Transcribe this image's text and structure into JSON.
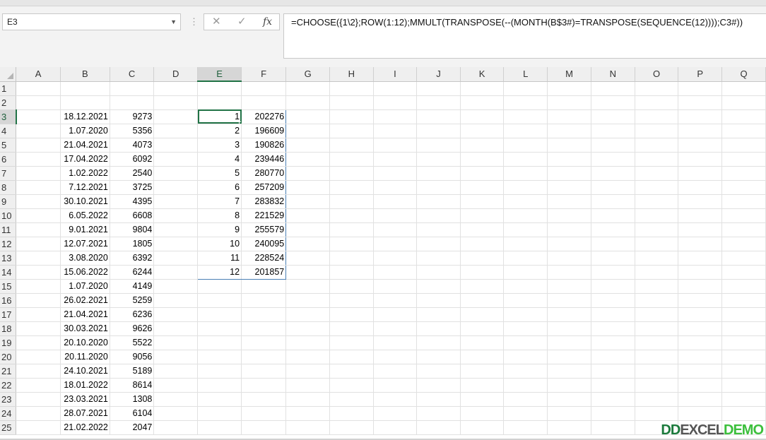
{
  "formula_bar": {
    "name_box": "E3",
    "formula": "=CHOOSE({1\\2};ROW(1:12);MMULT(TRANSPOSE(--(MONTH(B$3#)=TRANSPOSE(SEQUENCE(12))));C3#))",
    "cancel_icon": "cancel-x-icon",
    "enter_icon": "checkmark-icon",
    "fx_label": "fx"
  },
  "columns": [
    "A",
    "B",
    "C",
    "D",
    "E",
    "F",
    "G",
    "H",
    "I",
    "J",
    "K",
    "L",
    "M",
    "N",
    "O",
    "P",
    "Q"
  ],
  "selected_column": "E",
  "selected_row": "3",
  "rows": [
    {
      "n": "1",
      "B": "",
      "C": "",
      "E": "",
      "F": ""
    },
    {
      "n": "2",
      "B": "",
      "C": "",
      "E": "",
      "F": ""
    },
    {
      "n": "3",
      "B": "18.12.2021",
      "C": "9273",
      "E": "1",
      "F": "202276"
    },
    {
      "n": "4",
      "B": "1.07.2020",
      "C": "5356",
      "E": "2",
      "F": "196609"
    },
    {
      "n": "5",
      "B": "21.04.2021",
      "C": "4073",
      "E": "3",
      "F": "190826"
    },
    {
      "n": "6",
      "B": "17.04.2022",
      "C": "6092",
      "E": "4",
      "F": "239446"
    },
    {
      "n": "7",
      "B": "1.02.2022",
      "C": "2540",
      "E": "5",
      "F": "280770"
    },
    {
      "n": "8",
      "B": "7.12.2021",
      "C": "3725",
      "E": "6",
      "F": "257209"
    },
    {
      "n": "9",
      "B": "30.10.2021",
      "C": "4395",
      "E": "7",
      "F": "283832"
    },
    {
      "n": "10",
      "B": "6.05.2022",
      "C": "6608",
      "E": "8",
      "F": "221529"
    },
    {
      "n": "11",
      "B": "9.01.2021",
      "C": "9804",
      "E": "9",
      "F": "255579"
    },
    {
      "n": "12",
      "B": "12.07.2021",
      "C": "1805",
      "E": "10",
      "F": "240095"
    },
    {
      "n": "13",
      "B": "3.08.2020",
      "C": "6392",
      "E": "11",
      "F": "228524"
    },
    {
      "n": "14",
      "B": "15.06.2022",
      "C": "6244",
      "E": "12",
      "F": "201857"
    },
    {
      "n": "15",
      "B": "1.07.2020",
      "C": "4149",
      "E": "",
      "F": ""
    },
    {
      "n": "16",
      "B": "26.02.2021",
      "C": "5259",
      "E": "",
      "F": ""
    },
    {
      "n": "17",
      "B": "21.04.2021",
      "C": "6236",
      "E": "",
      "F": ""
    },
    {
      "n": "18",
      "B": "30.03.2021",
      "C": "9626",
      "E": "",
      "F": ""
    },
    {
      "n": "19",
      "B": "20.10.2020",
      "C": "5522",
      "E": "",
      "F": ""
    },
    {
      "n": "20",
      "B": "20.11.2020",
      "C": "9056",
      "E": "",
      "F": ""
    },
    {
      "n": "21",
      "B": "24.10.2021",
      "C": "5189",
      "E": "",
      "F": ""
    },
    {
      "n": "22",
      "B": "18.01.2022",
      "C": "8614",
      "E": "",
      "F": ""
    },
    {
      "n": "23",
      "B": "23.03.2021",
      "C": "1308",
      "E": "",
      "F": ""
    },
    {
      "n": "24",
      "B": "28.07.2021",
      "C": "6104",
      "E": "",
      "F": ""
    },
    {
      "n": "25",
      "B": "21.02.2022",
      "C": "2047",
      "E": "",
      "F": ""
    }
  ],
  "watermark": {
    "part1": "DD",
    "part2": "EXCEL",
    "part3": "DEMO"
  },
  "colors": {
    "accent": "#217346",
    "spill_border": "#4a7fb5"
  }
}
